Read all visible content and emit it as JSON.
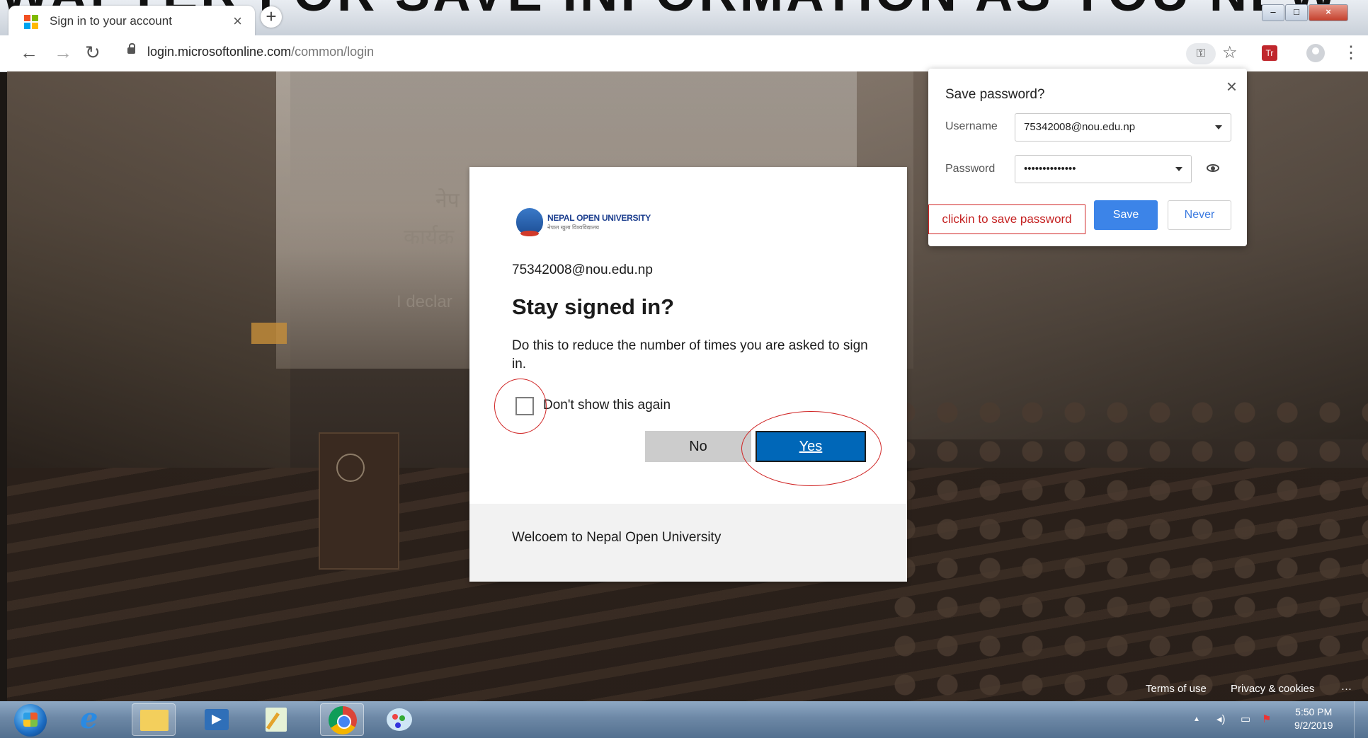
{
  "browser": {
    "background_headline": "WAPTER FOR SAVE INFORMATION AS YOU NEW",
    "tab_title": "Sign in to your account",
    "tab_close": "×",
    "new_tab": "+",
    "window_controls": [
      "–",
      "□",
      "×"
    ],
    "url_host": "login.microsoftonline.com",
    "url_path": "/common/login",
    "key_icon": "key-icon",
    "star_icon": "star-icon",
    "ext_label": "Tr",
    "menu": "⋮"
  },
  "backdrop": {
    "wall_text_1": "नेप",
    "wall_text_2": "कार्यक्र",
    "wall_text_3": "I declar",
    "footer_terms": "Terms of use",
    "footer_privacy": "Privacy & cookies",
    "footer_more": "···"
  },
  "dialog": {
    "logo_name": "NEPAL OPEN UNIVERSITY",
    "logo_sub": "नेपाल खुला विश्वविद्यालय",
    "account": "75342008@nou.edu.np",
    "heading": "Stay signed in?",
    "description": "Do this to reduce the number of times you are asked to sign in.",
    "checkbox_label": "Don't show this again",
    "no_label": "No",
    "yes_label": "Yes",
    "footer_text": "Welcoem to Nepal Open University",
    "colors": {
      "yes": "#0067b8",
      "no": "#cccccc",
      "annotation": "#d02525"
    }
  },
  "save_password": {
    "title": "Save password?",
    "close": "×",
    "username_label": "Username",
    "username_value": "75342008@nou.edu.np",
    "password_label": "Password",
    "password_value": "••••••••••••••",
    "save_label": "Save",
    "never_label": "Never",
    "annotation": "clickin to save password",
    "colors": {
      "save": "#3c84e8"
    }
  },
  "taskbar": {
    "clock_time": "5:50 PM",
    "clock_date": "9/2/2019",
    "tray_icons": [
      "▲",
      "◂)",
      "▭",
      "⚑"
    ]
  }
}
